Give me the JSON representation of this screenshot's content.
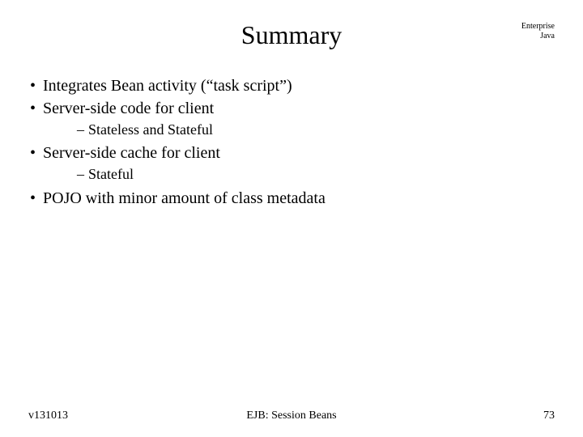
{
  "header": {
    "title": "Summary",
    "brand_line1": "Enterprise",
    "brand_line2": "Java"
  },
  "bullets": {
    "b1": "Integrates Bean activity (“task script”)",
    "b2": "Server-side code for client",
    "b2_sub1": "Stateless and Stateful",
    "b3": "Server-side cache for client",
    "b3_sub1": "Stateful",
    "b4": "POJO with minor amount of class metadata"
  },
  "footer": {
    "left": "v131013",
    "center": "EJB: Session Beans",
    "right": "73"
  }
}
